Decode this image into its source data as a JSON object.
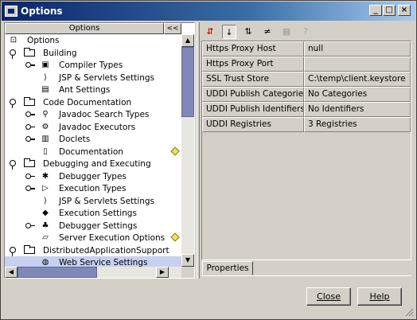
{
  "window": {
    "title": "Options"
  },
  "tree_header": {
    "label": "Options",
    "collapse": "<<"
  },
  "tree": [
    {
      "label": "Options",
      "icon": "options-root-icon",
      "level": 0,
      "pin": false,
      "key": false
    },
    {
      "label": "Building",
      "icon": "folder-icon",
      "level": 1,
      "pin": true
    },
    {
      "label": "Compiler Types",
      "icon": "compiler-icon",
      "level": 2,
      "key": true
    },
    {
      "label": "JSP & Servlets Settings",
      "icon": "jsp-icon",
      "level": 3
    },
    {
      "label": "Ant Settings",
      "icon": "ant-icon",
      "level": 3
    },
    {
      "label": "Code Documentation",
      "icon": "folder-icon",
      "level": 1,
      "pin": true
    },
    {
      "label": "Javadoc Search Types",
      "icon": "search-types-icon",
      "level": 2,
      "key": true
    },
    {
      "label": "Javadoc Executors",
      "icon": "executor-icon",
      "level": 2,
      "key": true
    },
    {
      "label": "Doclets",
      "icon": "doclet-icon",
      "level": 2,
      "key": true
    },
    {
      "label": "Documentation",
      "icon": "documentation-icon",
      "level": 3,
      "diamond": true
    },
    {
      "label": "Debugging and Executing",
      "icon": "folder-icon",
      "level": 1,
      "pin": true
    },
    {
      "label": "Debugger Types",
      "icon": "debugger-icon",
      "level": 2,
      "key": true
    },
    {
      "label": "Execution Types",
      "icon": "execution-icon",
      "level": 2,
      "key": true
    },
    {
      "label": "JSP & Servlets Settings",
      "icon": "jsp-icon",
      "level": 3
    },
    {
      "label": "Execution Settings",
      "icon": "execution-settings-icon",
      "level": 3
    },
    {
      "label": "Debugger Settings",
      "icon": "bug-icon",
      "level": 2,
      "key": true
    },
    {
      "label": "Server Execution Options",
      "icon": "server-icon",
      "level": 3,
      "diamond": true
    },
    {
      "label": "DistributedApplicationSupport",
      "icon": "folder-icon",
      "level": 1,
      "pin": true
    },
    {
      "label": "Web Service Settings",
      "icon": "web-service-icon",
      "level": 3,
      "selected": true
    }
  ],
  "toolbar": {
    "buttons": [
      {
        "name": "unsorted-icon",
        "glyph": "⇵",
        "state": "normal"
      },
      {
        "name": "sort-by-name-icon",
        "glyph": "↓",
        "state": "pressed"
      },
      {
        "name": "sort-by-type-icon",
        "glyph": "⇅",
        "state": "normal"
      },
      {
        "name": "filter-changed-icon",
        "glyph": "≠",
        "state": "normal"
      },
      {
        "name": "customize-icon",
        "glyph": "▦",
        "state": "disabled"
      },
      {
        "name": "help-icon",
        "glyph": "?",
        "state": "disabled"
      }
    ]
  },
  "properties": [
    {
      "name": "Https Proxy Host",
      "value": "null"
    },
    {
      "name": "Https Proxy Port",
      "value": ""
    },
    {
      "name": "SSL Trust Store",
      "value": "C:\\temp\\client.keystore"
    },
    {
      "name": "UDDI Publish Categories",
      "value": "No Categories"
    },
    {
      "name": "UDDI Publish Identifiers",
      "value": "No Identifiers"
    },
    {
      "name": "UDDI Registries",
      "value": "3 Registries"
    }
  ],
  "tabs": {
    "properties": "Properties"
  },
  "buttons": {
    "close": "Close",
    "help": "Help"
  },
  "colors": {
    "title_start": "#0a246a",
    "selection": "#c8d0f0",
    "scroll_thumb": "#8088b8",
    "face": "#d4d0c8"
  }
}
